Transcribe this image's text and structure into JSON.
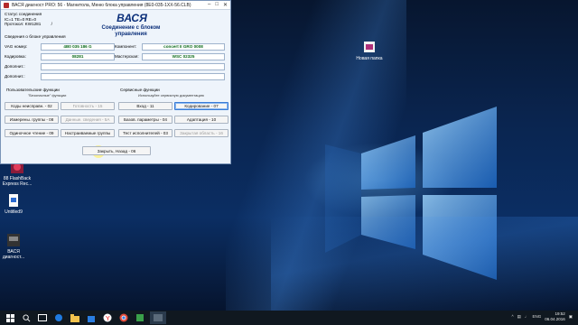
{
  "window": {
    "title": "ВАСЯ диагност PRO: 56 - Магнитола, Меню блока управления (8E0-035-1XX-56.CLB)"
  },
  "header": {
    "logo": "ВАСЯ",
    "connection_line1": "Соединение с блоком",
    "connection_line2": "управления",
    "status_label": "Статус соединения",
    "status_values": "IC=1  TE=0  RE=0",
    "protocol_label": "Протокол: KW1281",
    "protocol_suffix": "/"
  },
  "unit_info": {
    "title": "Сведения о блоке управления",
    "vag_label": "VAG номер:",
    "vag_value": "4B0 035 186 G",
    "component_label": "Компонент:",
    "component_value": "concert II  GRO    0008",
    "coding_label": "Кодировка:",
    "coding_value": "08281",
    "workshop_label": "Мастерская:",
    "workshop_value": "WSC 02325",
    "extra1_label": "Дополнит.:",
    "extra2_label": "Дополнит.:"
  },
  "basic": {
    "title": "Пользовательские функции",
    "subtitle": "\"Безопасные\" функции",
    "buttons": {
      "fault_codes": "Коды неисправн. - 02",
      "readiness": "Готовность - 15",
      "measuring": "Измерены. группы - 08",
      "adv_meas": "Данные. сведения - 5A",
      "single_read": "Одиночное чтение - 09",
      "adaptive_groups": "Настраиваемые группы"
    }
  },
  "advanced": {
    "title": "Сервисные функции",
    "subtitle": "Используйте сервисную документацию",
    "buttons": {
      "login": "Вход - 11",
      "coding": "Кодирование - 07",
      "basic_settings": "Базов. параметры - 04",
      "adaptation": "Адаптация - 10",
      "output_test": "Тест исполнителей - 03",
      "security": "Закрытая область - 16"
    }
  },
  "footer": {
    "back_button": "Закрыть, Назад - 06"
  },
  "desktop": {
    "icons": [
      {
        "label": "Новая папка"
      },
      {
        "label": "88 FlashBack Express Rec..."
      },
      {
        "label": "Untitled9"
      },
      {
        "label": "ВАСЯ диагност..."
      }
    ]
  },
  "taskbar": {
    "lang": "ENG",
    "time": "19:52",
    "date": "06.04.2016"
  },
  "colors": {
    "accent_blue": "#0b2f7a",
    "value_green": "#0c6a1a",
    "wallpaper": "#0b2e63"
  }
}
